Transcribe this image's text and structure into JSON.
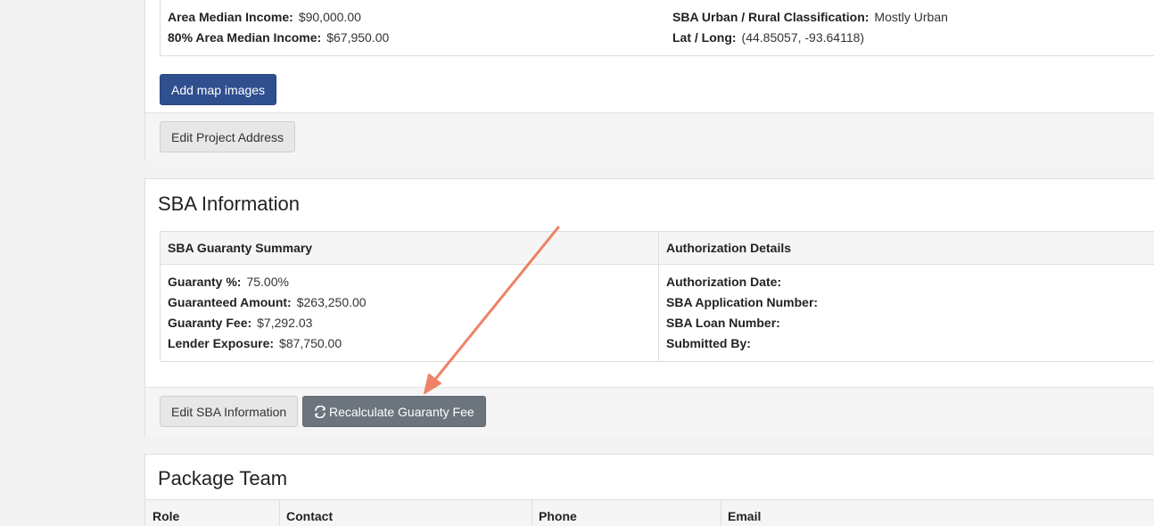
{
  "address": {
    "lines": [
      {
        "label": "Area Median Income:",
        "value": "$90,000.00"
      },
      {
        "label": "80% Area Median Income:",
        "value": "$67,950.00"
      },
      {
        "label": "SBA Urban / Rural Classification:",
        "value": "Mostly Urban"
      },
      {
        "label": "Lat / Long:",
        "value": "(44.85057, -93.64118)"
      }
    ],
    "add_map_images_label": "Add map images",
    "edit_address_label": "Edit Project Address"
  },
  "sba": {
    "title": "SBA Information",
    "summary_header": "SBA Guaranty Summary",
    "auth_header": "Authorization Details",
    "summary": [
      {
        "label": "Guaranty %:",
        "value": "75.00%"
      },
      {
        "label": "Guaranteed Amount:",
        "value": "$263,250.00"
      },
      {
        "label": "Guaranty Fee:",
        "value": "$7,292.03"
      },
      {
        "label": "Lender Exposure:",
        "value": "$87,750.00"
      }
    ],
    "auth": [
      {
        "label": "Authorization Date:",
        "value": ""
      },
      {
        "label": "SBA Application Number:",
        "value": ""
      },
      {
        "label": "SBA Loan Number:",
        "value": ""
      },
      {
        "label": "Submitted By:",
        "value": ""
      }
    ],
    "edit_label": "Edit SBA Information",
    "recalc_label": "Recalculate Guaranty Fee"
  },
  "team": {
    "title": "Package Team",
    "columns": [
      "Role",
      "Contact",
      "Phone",
      "Email"
    ]
  },
  "colors": {
    "primary": "#2f4f8f",
    "arrow": "#ee8266"
  }
}
